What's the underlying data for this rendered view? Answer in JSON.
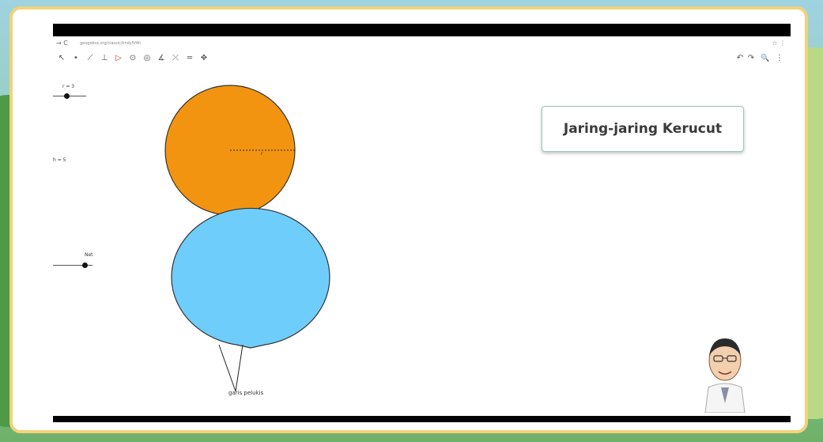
{
  "browser": {
    "nav_glyphs": "→ C",
    "url": "geogebra.org/classic/kndy5f4h",
    "right_glyphs": "☆ ⋮"
  },
  "toolbar": {
    "tools": [
      {
        "icon": "move-icon",
        "glyph": "↖"
      },
      {
        "icon": "point-icon",
        "glyph": "•"
      },
      {
        "icon": "line-icon",
        "glyph": "⟋"
      },
      {
        "icon": "perpendicular-icon",
        "glyph": "⊥"
      },
      {
        "icon": "polygon-icon",
        "glyph": "▷"
      },
      {
        "icon": "circle-icon",
        "glyph": "⊙"
      },
      {
        "icon": "circle-three-points-icon",
        "glyph": "◎"
      },
      {
        "icon": "angle-icon",
        "glyph": "∡"
      },
      {
        "icon": "reflect-icon",
        "glyph": "⤫"
      },
      {
        "icon": "slider-icon",
        "glyph": "═"
      },
      {
        "icon": "move-graphics-icon",
        "glyph": "✥"
      }
    ],
    "undo_glyph": "↶",
    "redo_glyph": "↷",
    "search_glyph": "🔍",
    "menu_glyph": "⋮"
  },
  "sliders": {
    "r_label": "r = 3",
    "h_label": "h = 5",
    "net_label": "Net"
  },
  "annotations": {
    "radius_label": "r",
    "tangent_label": "garis pelukis"
  },
  "title": "Jaring-jaring Kerucut",
  "colors": {
    "circle_fill": "#f39410",
    "sector_fill": "#6fcdfb",
    "frame_border": "#f2d27a"
  }
}
